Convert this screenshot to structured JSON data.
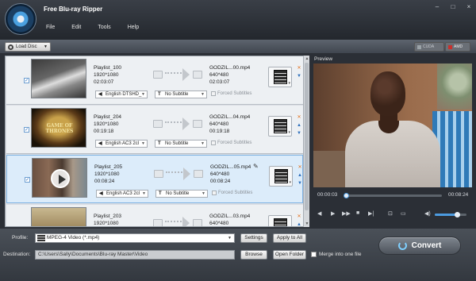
{
  "app": {
    "title": "Free Blu-ray Ripper"
  },
  "menu": [
    "File",
    "Edit",
    "Tools",
    "Help"
  ],
  "window_controls": [
    "–",
    "□",
    "×"
  ],
  "toolbar": {
    "load_disc": "Load Disc",
    "cuda": "CUDA",
    "amd": "AMD"
  },
  "rows": [
    {
      "name": "Playlist_100",
      "res": "1920*1080",
      "duration": "02:03:07",
      "out_name": "GODZIL...00.mp4",
      "out_res": "640*480",
      "out_duration": "02:03:07",
      "audio": "English DTSHD_",
      "subtitle": "No Subtitle",
      "forced": "Forced Subtitles"
    },
    {
      "name": "Playlist_204",
      "res": "1920*1080",
      "duration": "00:19:18",
      "out_name": "GODZIL...04.mp4",
      "out_res": "640*480",
      "out_duration": "00:19:18",
      "audio": "English AC3 2cl",
      "subtitle": "No Subtitle",
      "forced": "Forced Subtitles",
      "thumb_text": "GAME OF THRONES"
    },
    {
      "name": "Playlist_205",
      "res": "1920*1080",
      "duration": "00:08:24",
      "out_name": "GODZIL...05.mp4",
      "out_res": "640*480",
      "out_duration": "00:08:24",
      "audio": "English AC3 2cl",
      "subtitle": "No Subtitle",
      "forced": "Forced Subtitles"
    },
    {
      "name": "Playlist_203",
      "res": "1920*1080",
      "duration": "",
      "out_name": "GODZIL...03.mp4",
      "out_res": "640*480",
      "out_duration": ""
    }
  ],
  "preview": {
    "label": "Preview",
    "current_time": "00:00:03",
    "total_time": "00:08:24",
    "progress": 0.01,
    "volume": 0.7
  },
  "bottom": {
    "profile_label": "Profile:",
    "profile_value": "MPEG-4 Video (*.mp4)",
    "settings": "Settings",
    "apply_all": "Apply to All",
    "destination_label": "Destination:",
    "destination_value": "C:\\Users\\Sally\\Documents\\Blu-ray Master\\Video",
    "browse": "Browse",
    "open_folder": "Open Folder",
    "merge": "Merge into one file",
    "convert": "Convert"
  }
}
